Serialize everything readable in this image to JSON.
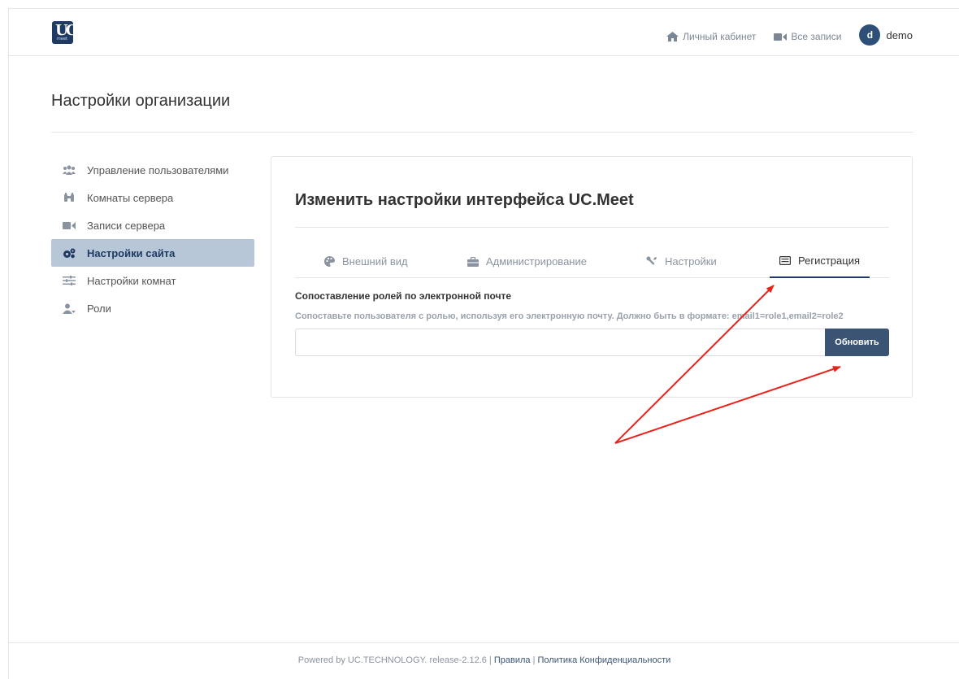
{
  "header": {
    "logo_text": "UC",
    "logo_sub": "meet",
    "nav": [
      {
        "label": "Личный кабинет",
        "icon": "home-icon"
      },
      {
        "label": "Все записи",
        "icon": "video-camera-icon"
      }
    ],
    "user": {
      "initial": "d",
      "name": "demo"
    }
  },
  "page": {
    "title": "Настройки организации"
  },
  "sidebar": {
    "items": [
      {
        "label": "Управление пользователями",
        "icon": "users-icon"
      },
      {
        "label": "Комнаты сервера",
        "icon": "binoculars-icon"
      },
      {
        "label": "Записи сервера",
        "icon": "video-camera-icon"
      },
      {
        "label": "Настройки сайта",
        "icon": "cogs-icon",
        "active": true
      },
      {
        "label": "Настройки комнат",
        "icon": "sliders-icon"
      },
      {
        "label": "Роли",
        "icon": "user-role-icon"
      }
    ]
  },
  "card": {
    "title": "Изменить настройки интерфейса UC.Meet",
    "tabs": [
      {
        "label": "Внешний вид",
        "icon": "palette-icon"
      },
      {
        "label": "Администрирование",
        "icon": "briefcase-icon"
      },
      {
        "label": "Настройки",
        "icon": "tools-icon"
      },
      {
        "label": "Регистрация",
        "icon": "id-card-icon",
        "active": true
      }
    ],
    "field": {
      "label": "Сопоставление ролей по электронной почте",
      "help": "Сопоставьте пользователя с ролью, используя его электронную почту. Должно быть в формате: email1=role1,email2=role2",
      "value": "",
      "placeholder": ""
    },
    "update_button": "Обновить"
  },
  "footer": {
    "powered": "Powered by UC.TECHNOLOGY. release-2.12.6 | ",
    "rules": "Правила",
    "sep": " | ",
    "privacy": "Политика Конфиденциальности"
  },
  "annotation_color": "#e8231b"
}
